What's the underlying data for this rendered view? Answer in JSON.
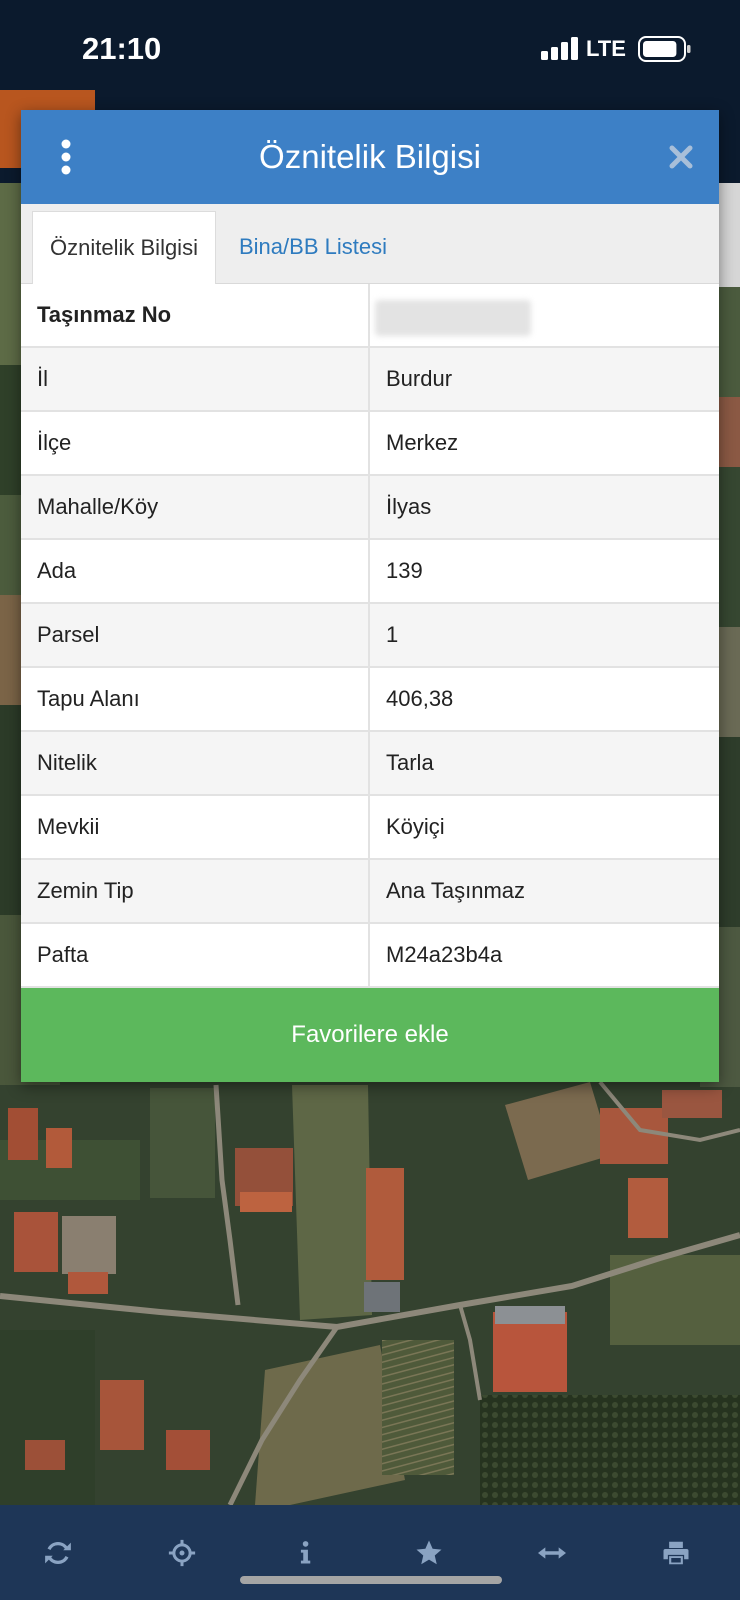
{
  "status_bar": {
    "time": "21:10",
    "network": "LTE",
    "signal_bars": 4,
    "battery_level": 0.88
  },
  "dialog": {
    "title": "Öznitelik Bilgisi",
    "menu_icon": "more-vertical-icon",
    "close_icon": "close-icon",
    "tabs": [
      {
        "label": "Öznitelik Bilgisi",
        "active": true
      },
      {
        "label": "Bina/BB Listesi",
        "active": false
      }
    ],
    "rows": [
      {
        "label": "Taşınmaz No",
        "value_redacted": true
      },
      {
        "label": "İl",
        "value": "Burdur"
      },
      {
        "label": "İlçe",
        "value": "Merkez"
      },
      {
        "label": "Mahalle/Köy",
        "value": "İlyas"
      },
      {
        "label": "Ada",
        "value": "139"
      },
      {
        "label": "Parsel",
        "value": "1"
      },
      {
        "label": "Tapu Alanı",
        "value": "406,38"
      },
      {
        "label": "Nitelik",
        "value": "Tarla"
      },
      {
        "label": "Mevkii",
        "value": "Köyiçi"
      },
      {
        "label": "Zemin Tip",
        "value": "Ana Taşınmaz"
      },
      {
        "label": "Pafta",
        "value": "M24a23b4a"
      }
    ],
    "favorite_button": "Favorilere ekle"
  },
  "toolbar": {
    "items": [
      {
        "icon": "refresh-icon"
      },
      {
        "icon": "crosshair-icon"
      },
      {
        "icon": "info-icon"
      },
      {
        "icon": "star-icon"
      },
      {
        "icon": "arrows-horizontal-icon"
      },
      {
        "icon": "printer-icon"
      }
    ]
  },
  "colors": {
    "status_bar": "#0b1a2d",
    "dialog_header": "#3d80c6",
    "tab_link": "#2e7bbf",
    "favorite_button": "#5cb85c",
    "toolbar": "#1e3657",
    "toolbar_icon": "#8aa3c2"
  }
}
